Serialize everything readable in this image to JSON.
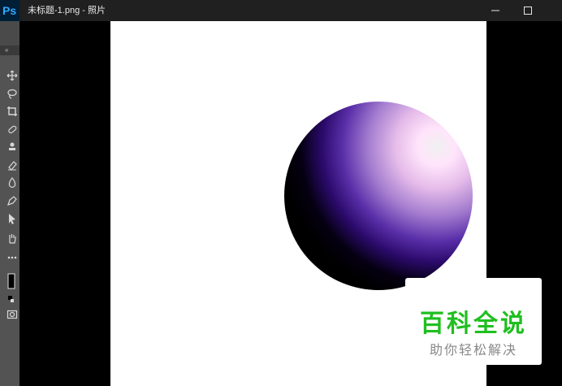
{
  "app": {
    "logo_text": "Ps",
    "collapse_glyph": "«"
  },
  "window": {
    "title": "未标题-1.png - 照片",
    "controls": [
      "minimize-icon",
      "maximize-icon"
    ]
  },
  "toolbar": {
    "tools": [
      "move-icon",
      "lasso-icon",
      "crop-icon",
      "healing-brush-icon",
      "clone-stamp-icon",
      "eraser-icon",
      "blur-drop-icon",
      "pen-icon",
      "path-selection-icon",
      "hand-icon",
      "more-tools-icon",
      "foreground-color-icon",
      "quick-mask-icon"
    ]
  },
  "image": {
    "subject": "purple glossy sphere",
    "colors": {
      "highlight": "#f0f0f0",
      "mid": "#a37ccf",
      "deep": "#2b0a6b",
      "shadow": "#000000"
    }
  },
  "watermark": {
    "title": "百科全说",
    "subtitle": "助你轻松解决",
    "color": "#1fbf1f"
  }
}
